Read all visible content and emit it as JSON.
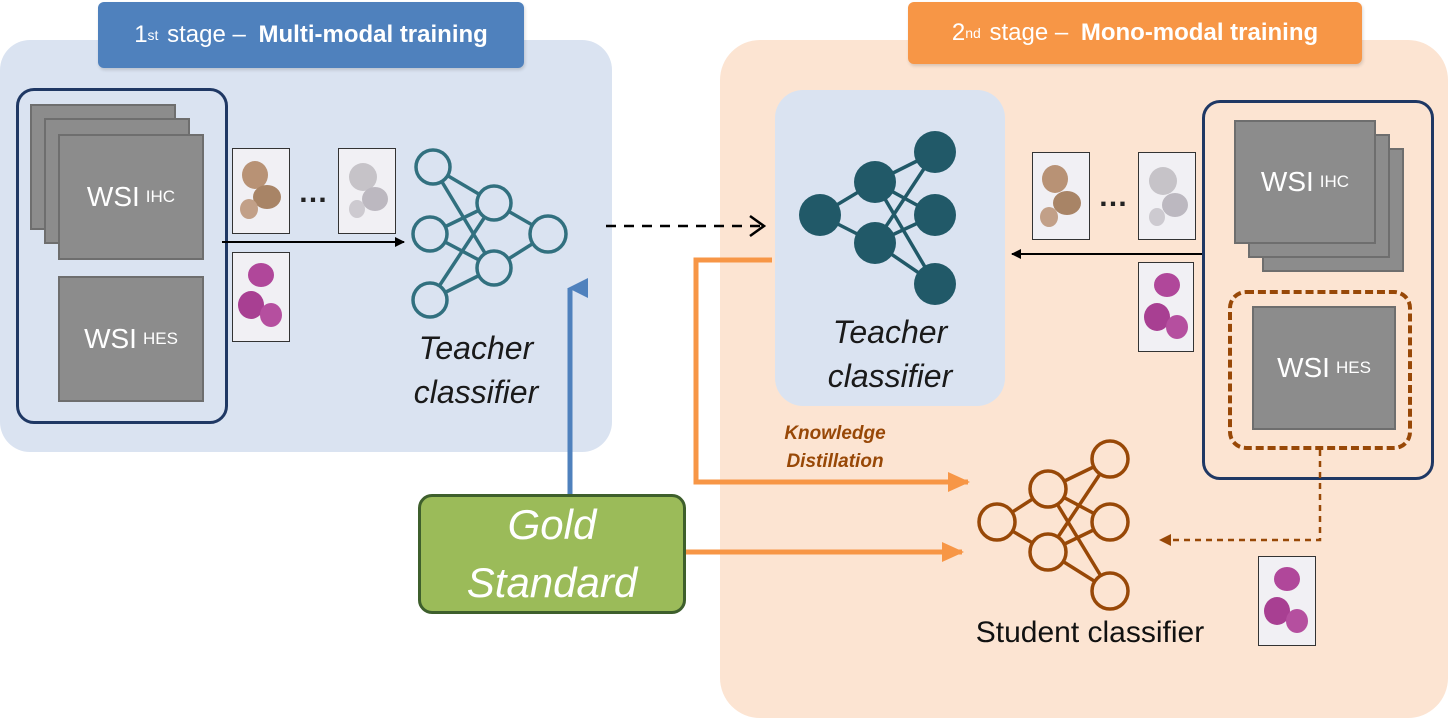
{
  "stage1": {
    "sup": "st",
    "prefix": "1",
    "middle": " stage – ",
    "bold": "Multi-modal training"
  },
  "stage2": {
    "sup": "nd",
    "prefix": "2",
    "middle": " stage – ",
    "bold": "Mono-modal training"
  },
  "wsi_ihc": {
    "main": "WSI",
    "sub": "IHC"
  },
  "wsi_hes": {
    "main": "WSI",
    "sub": "HES"
  },
  "ellipsis": "…",
  "teacher_left": {
    "line1": "Teacher",
    "line2": "classifier"
  },
  "teacher_right": {
    "line1": "Teacher",
    "line2": "classifier"
  },
  "knowledge_distillation": {
    "line1": "Knowledge",
    "line2": "Distillation"
  },
  "gold_standard": {
    "line1": "Gold",
    "line2": "Standard"
  },
  "student_label": "Student classifier",
  "colors": {
    "blue_panel": "#dae3f1",
    "orange_panel": "#fce4d2",
    "stage1": "#4f81bd",
    "stage2": "#f79646",
    "gold": "#9bbb59",
    "teacher_net_right": "#215968",
    "teacher_net_left": "#31707f",
    "student_net": "#984807",
    "arrow_orange": "#f79646",
    "arrow_blue": "#4f81bd"
  }
}
